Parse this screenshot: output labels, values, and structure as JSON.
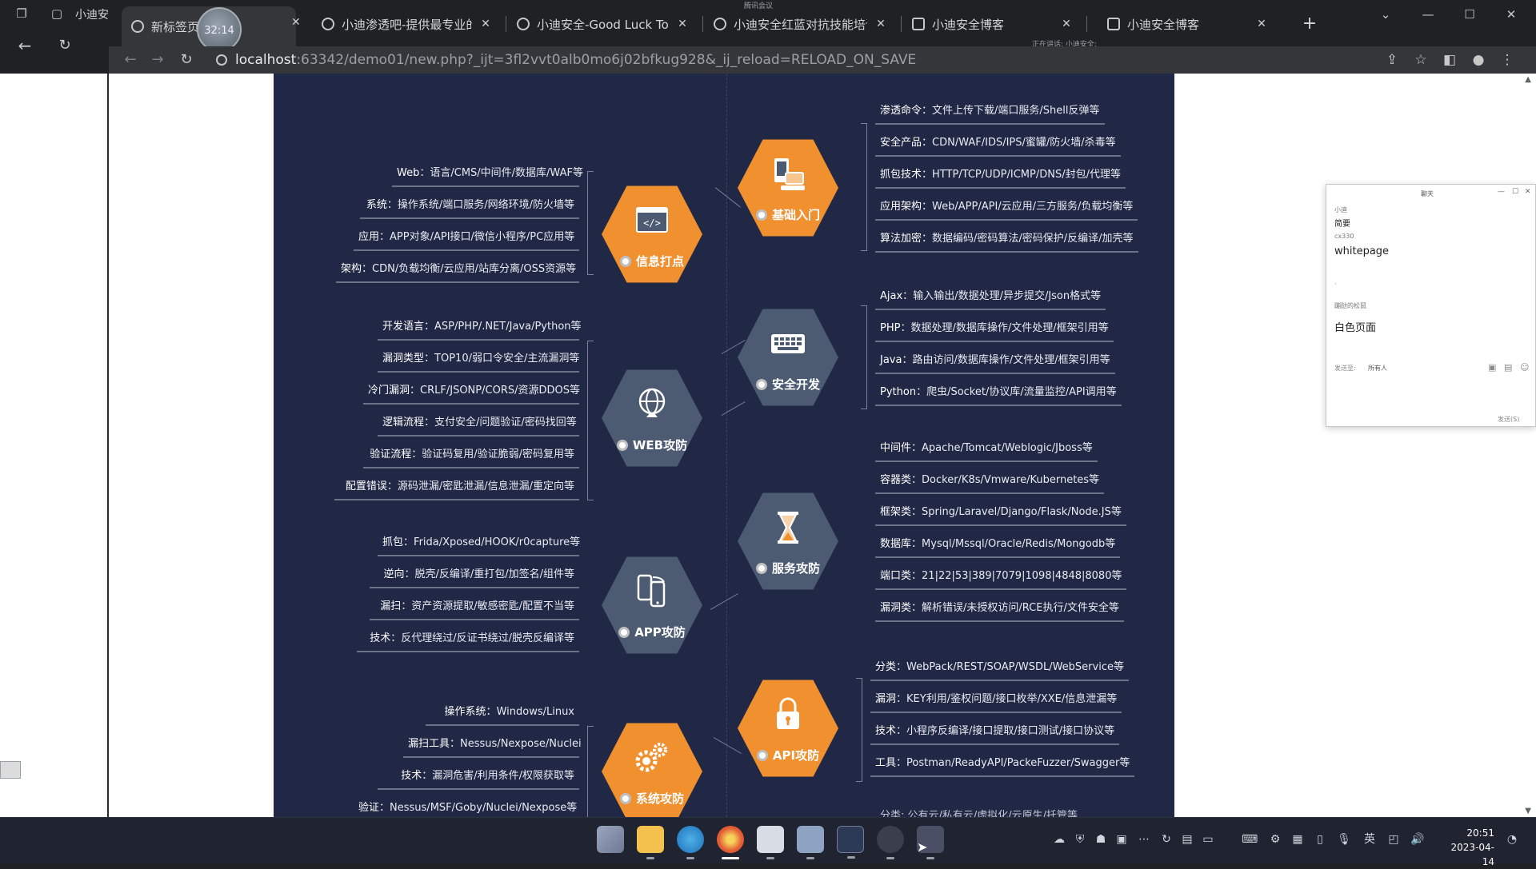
{
  "browser": {
    "left_window_tab": "小迪安",
    "tabs": [
      {
        "label": "新标签页",
        "active": true
      },
      {
        "label": "小迪渗透吧-提供最专业的渗",
        "active": false
      },
      {
        "label": "小迪安全-Good Luck To Yo",
        "active": false
      },
      {
        "label": "小迪安全红蓝对抗技能培训",
        "active": false
      },
      {
        "label": "小迪安全博客",
        "active": false
      },
      {
        "label": "小迪安全博客",
        "active": false
      }
    ],
    "recording_time": "32:14",
    "meeting_top_text": "腾讯会议",
    "sharing_note": "正在讲话: 小迪安全;",
    "url_host": "localhost",
    "url_rest": ":63342/demo01/new.php?_ijt=3fl2vvt0alb0mo6j02bfkug928&_ij_reload=RELOAD_ON_SAVE"
  },
  "mindmap": {
    "colors": {
      "orange": "#f0902e",
      "slate": "#4c5a72",
      "background": "#212845"
    },
    "nodes": {
      "jichu": {
        "label": "基础入门",
        "icon": "computer-icon",
        "style": "orange"
      },
      "xinxi": {
        "label": "信息打点",
        "icon": "code-window-icon",
        "style": "orange"
      },
      "anquan": {
        "label": "安全开发",
        "icon": "keyboard-icon",
        "style": "slate"
      },
      "web": {
        "label": "WEB攻防",
        "icon": "globe-icon",
        "style": "slate"
      },
      "fuwu": {
        "label": "服务攻防",
        "icon": "hourglass-icon",
        "style": "slate"
      },
      "app": {
        "label": "APP攻防",
        "icon": "phones-icon",
        "style": "slate"
      },
      "api": {
        "label": "API攻防",
        "icon": "lock-icon",
        "style": "orange"
      },
      "xitong": {
        "label": "系统攻防",
        "icon": "gears-icon",
        "style": "orange"
      }
    },
    "jichu_items": [
      {
        "k": "渗透命令",
        "v": "文件上传下载/端口服务/Shell反弹等"
      },
      {
        "k": "安全产品",
        "v": "CDN/WAF/IDS/IPS/蜜罐/防火墙/杀毒等"
      },
      {
        "k": "抓包技术",
        "v": "HTTP/TCP/UDP/ICMP/DNS/封包/代理等"
      },
      {
        "k": "应用架构",
        "v": "Web/APP/API/云应用/三方服务/负载均衡等"
      },
      {
        "k": "算法加密",
        "v": "数据编码/密码算法/密码保护/反编译/加壳等"
      }
    ],
    "xinxi_items": [
      {
        "k": "Web",
        "v": "语言/CMS/中间件/数据库/WAF等"
      },
      {
        "k": "系统",
        "v": "操作系统/端口服务/网络环境/防火墙等"
      },
      {
        "k": "应用",
        "v": "APP对象/API接口/微信小程序/PC应用等"
      },
      {
        "k": "架构",
        "v": "CDN/负载均衡/云应用/站库分离/OSS资源等"
      }
    ],
    "anquan_items": [
      {
        "k": "Ajax",
        "v": "输入输出/数据处理/异步提交/Json格式等"
      },
      {
        "k": "PHP",
        "v": "数据处理/数据库操作/文件处理/框架引用等"
      },
      {
        "k": "Java",
        "v": "路由访问/数据库操作/文件处理/框架引用等"
      },
      {
        "k": "Python",
        "v": "爬虫/Socket/协议库/流量监控/API调用等"
      }
    ],
    "web_items": [
      {
        "k": "开发语言",
        "v": "ASP/PHP/.NET/Java/Python等"
      },
      {
        "k": "漏洞类型",
        "v": "TOP10/弱口令安全/主流漏洞等"
      },
      {
        "k": "冷门漏洞",
        "v": "CRLF/JSONP/CORS/资源DDOS等"
      },
      {
        "k": "逻辑流程",
        "v": "支付安全/问题验证/密码找回等"
      },
      {
        "k": "验证流程",
        "v": "验证码复用/验证脆弱/密码复用等"
      },
      {
        "k": "配置错误",
        "v": "源码泄漏/密匙泄漏/信息泄漏/重定向等"
      }
    ],
    "fuwu_items": [
      {
        "k": "中间件",
        "v": "Apache/Tomcat/Weblogic/Jboss等"
      },
      {
        "k": "容器类",
        "v": "Docker/K8s/Vmware/Kubernetes等"
      },
      {
        "k": "框架类",
        "v": "Spring/Laravel/Django/Flask/Node.JS等"
      },
      {
        "k": "数据库",
        "v": "Mysql/Mssql/Oracle/Redis/Mongodb等"
      },
      {
        "k": "端口类",
        "v": "21|22|53|389|7079|1098|4848|8080等"
      },
      {
        "k": "漏洞类",
        "v": "解析错误/未授权访问/RCE执行/文件安全等"
      }
    ],
    "app_items": [
      {
        "k": "抓包",
        "v": "Frida/Xposed/HOOK/r0capture等"
      },
      {
        "k": "逆向",
        "v": "脱壳/反编译/重打包/加签名/组件等"
      },
      {
        "k": "漏扫",
        "v": "资产资源提取/敏感密匙/配置不当等"
      },
      {
        "k": "技术",
        "v": "反代理绕过/反证书绕过/脱壳反编译等"
      }
    ],
    "api_items": [
      {
        "k": "分类",
        "v": "WebPack/REST/SOAP/WSDL/WebService等"
      },
      {
        "k": "漏洞",
        "v": "KEY利用/鉴权问题/接口枚举/XXE/信息泄漏等"
      },
      {
        "k": "技术",
        "v": "小程序反编译/接口提取/接口测试/接口协议等"
      },
      {
        "k": "工具",
        "v": "Postman/ReadyAPI/PackeFuzzer/Swagger等"
      }
    ],
    "xitong_items": [
      {
        "k": "操作系统",
        "v": "Windows/Linux"
      },
      {
        "k": "漏扫工具",
        "v": "Nessus/Nexpose/Nuclei"
      },
      {
        "k": "技术",
        "v": "漏洞危害/利用条件/权限获取等"
      },
      {
        "k": "验证",
        "v": "Nessus/MSF/Goby/Nuclei/Nexpose等"
      }
    ],
    "cut_off_text": "分类: 公有云/私有云/虚拟化/云原生/托管等"
  },
  "chat": {
    "title": "聊天",
    "messages": [
      {
        "name": "小迪",
        "text": "简要"
      },
      {
        "name": "cx330",
        "text": "whitepage"
      },
      {
        "name": "·",
        "text": ""
      },
      {
        "name": "蹦跶的松鼠",
        "text": "白色页面"
      }
    ],
    "send_to_label": "发送至:",
    "send_to_value": "所有人",
    "footer_note": "发送(S)"
  },
  "taskbar": {
    "time": "20:51",
    "date": "2023-04-14",
    "ime": "英"
  }
}
